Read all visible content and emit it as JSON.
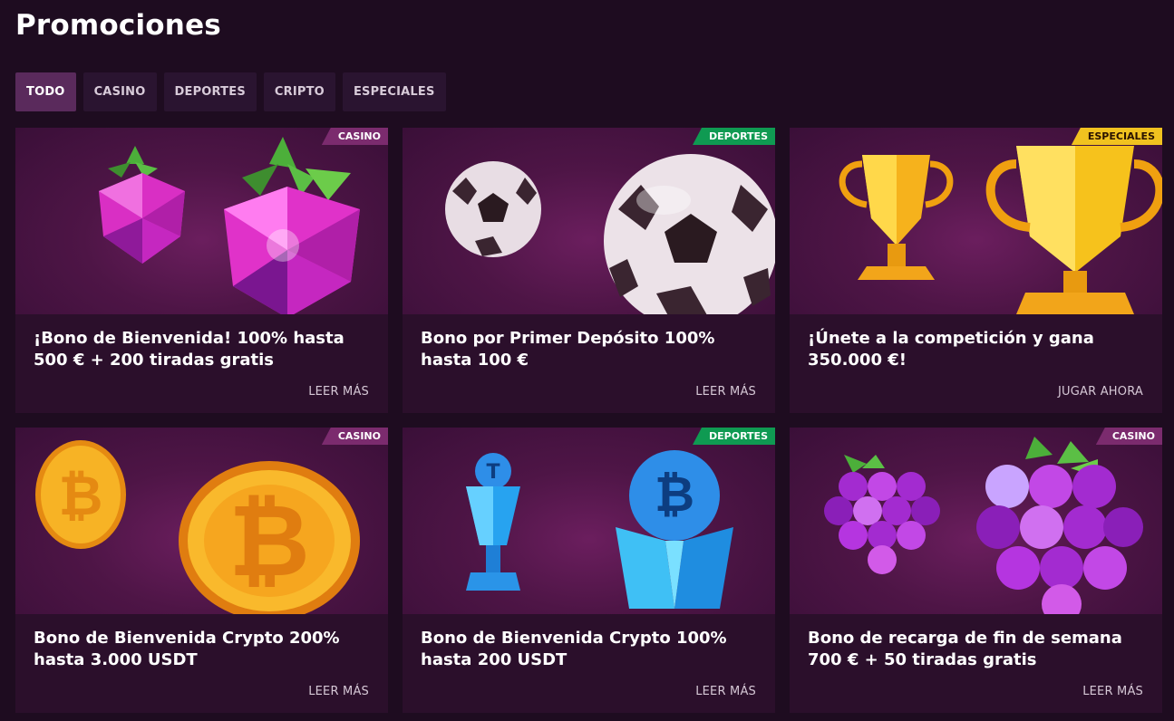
{
  "page": {
    "title": "Promociones"
  },
  "tabs": [
    {
      "label": "TODO",
      "active": true
    },
    {
      "label": "CASINO",
      "active": false
    },
    {
      "label": "DEPORTES",
      "active": false
    },
    {
      "label": "CRIPTO",
      "active": false
    },
    {
      "label": "ESPECIALES",
      "active": false
    }
  ],
  "cards": [
    {
      "badge": "CASINO",
      "title": "¡Bono de Bienvenida! 100% hasta 500 € + 200 tiradas gratis",
      "cta": "LEER MÁS",
      "art": "raspberry-icon"
    },
    {
      "badge": "DEPORTES",
      "title": "Bono por Primer Depósito 100% hasta 100 €",
      "cta": "LEER MÁS",
      "art": "soccer-ball-icon"
    },
    {
      "badge": "ESPECIALES",
      "title": "¡Únete a la competición y gana 350.000 €!",
      "cta": "JUGAR AHORA",
      "art": "trophy-icon"
    },
    {
      "badge": "CASINO",
      "title": "Bono de Bienvenida Crypto 200% hasta 3.000 USDT",
      "cta": "LEER MÁS",
      "art": "bitcoin-coin-icon"
    },
    {
      "badge": "DEPORTES",
      "title": "Bono de Bienvenida Crypto 100% hasta 200 USDT",
      "cta": "LEER MÁS",
      "art": "crypto-trophy-icon"
    },
    {
      "badge": "CASINO",
      "title": "Bono de recarga de fin de semana 700 € + 50 tiradas gratis",
      "cta": "LEER MÁS",
      "art": "grapes-icon"
    }
  ],
  "colors": {
    "background": "#1e0c20",
    "tab_active": "#5a2a5c",
    "badge_casino": "#7b2b6e",
    "badge_deportes": "#0f9a52",
    "badge_especiales": "#f1c21f"
  }
}
